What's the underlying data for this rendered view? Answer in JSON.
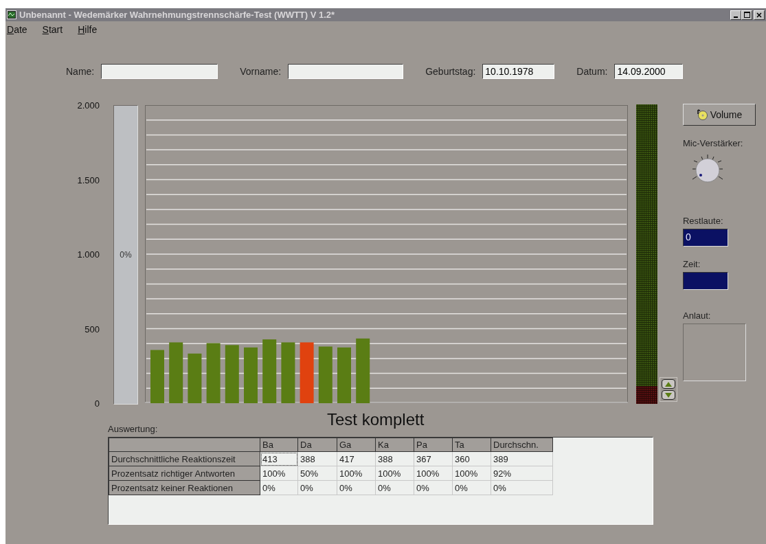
{
  "window": {
    "title": "Unbenannt - Wedemärker Wahrnehmungstrennschärfe-Test (WWTT) V 1.2*"
  },
  "menu": [
    {
      "label": "Date"
    },
    {
      "label": "Start"
    },
    {
      "label": "Hilfe"
    }
  ],
  "form": [
    {
      "label": "Name:"
    },
    {
      "label": "Vorname:"
    },
    {
      "label": "Geburtstag:",
      "value": "10.10.1978"
    },
    {
      "label": "Datum:",
      "value": "14.09.2000"
    }
  ],
  "gauge": {
    "label": "0%",
    "level": 0
  },
  "chart": {
    "upper_y_axis_labels": [
      "2.000",
      "1.500",
      "1.000"
    ],
    "chart_data": {
      "type": "bar",
      "ylim": [
        0,
        2000
      ],
      "yticks": [
        0,
        500
      ],
      "stacked": true,
      "grid": true,
      "series": [
        {
          "color": "#5a7d14",
          "values": [
            357,
            408,
            333,
            403,
            390,
            374,
            428,
            408,
            null,
            380,
            374,
            434
          ]
        },
        {
          "color": "#e0420f",
          "values": [
            null,
            null,
            null,
            null,
            null,
            null,
            null,
            null,
            408,
            null,
            null,
            null
          ]
        }
      ]
    }
  },
  "right_panel": {
    "volume_button": "Volume",
    "mic_label": "Mic-Verstärker:",
    "restlaute_label": "Restlaute:",
    "restlaute_value": "0",
    "zeit_label": "Zeit:",
    "anlaut_label": "Anlaut:"
  },
  "status": "Test komplett",
  "evaluation": {
    "label": "Auswertung:",
    "columns": [
      "Ba",
      "Da",
      "Ga",
      "Ka",
      "Pa",
      "Ta",
      "Durchschn."
    ],
    "rows": [
      {
        "label": "Durchschnittliche Reaktionszeit",
        "cells": [
          {
            "text": "413",
            "selected": true
          },
          {
            "text": "388",
            "selected": false
          },
          {
            "text": "417",
            "selected": false
          },
          {
            "text": "388",
            "selected": false
          },
          {
            "text": "367",
            "selected": false
          },
          {
            "text": "360",
            "selected": false
          },
          {
            "text": "389",
            "selected": false
          }
        ]
      },
      {
        "label": "Prozentsatz richtiger Antworten",
        "cells": [
          {
            "text": "100%",
            "selected": false
          },
          {
            "text": "50%",
            "selected": false
          },
          {
            "text": "100%",
            "selected": false
          },
          {
            "text": "100%",
            "selected": false
          },
          {
            "text": "100%",
            "selected": false
          },
          {
            "text": "100%",
            "selected": false
          },
          {
            "text": "92%",
            "selected": false
          }
        ]
      },
      {
        "label": "Prozentsatz keiner Reaktionen",
        "cells": [
          {
            "text": "0%",
            "selected": false
          },
          {
            "text": "0%",
            "selected": false
          },
          {
            "text": "0%",
            "selected": false
          },
          {
            "text": "0%",
            "selected": false
          },
          {
            "text": "0%",
            "selected": false
          },
          {
            "text": "0%",
            "selected": false
          },
          {
            "text": "0%",
            "selected": false
          }
        ]
      }
    ]
  }
}
